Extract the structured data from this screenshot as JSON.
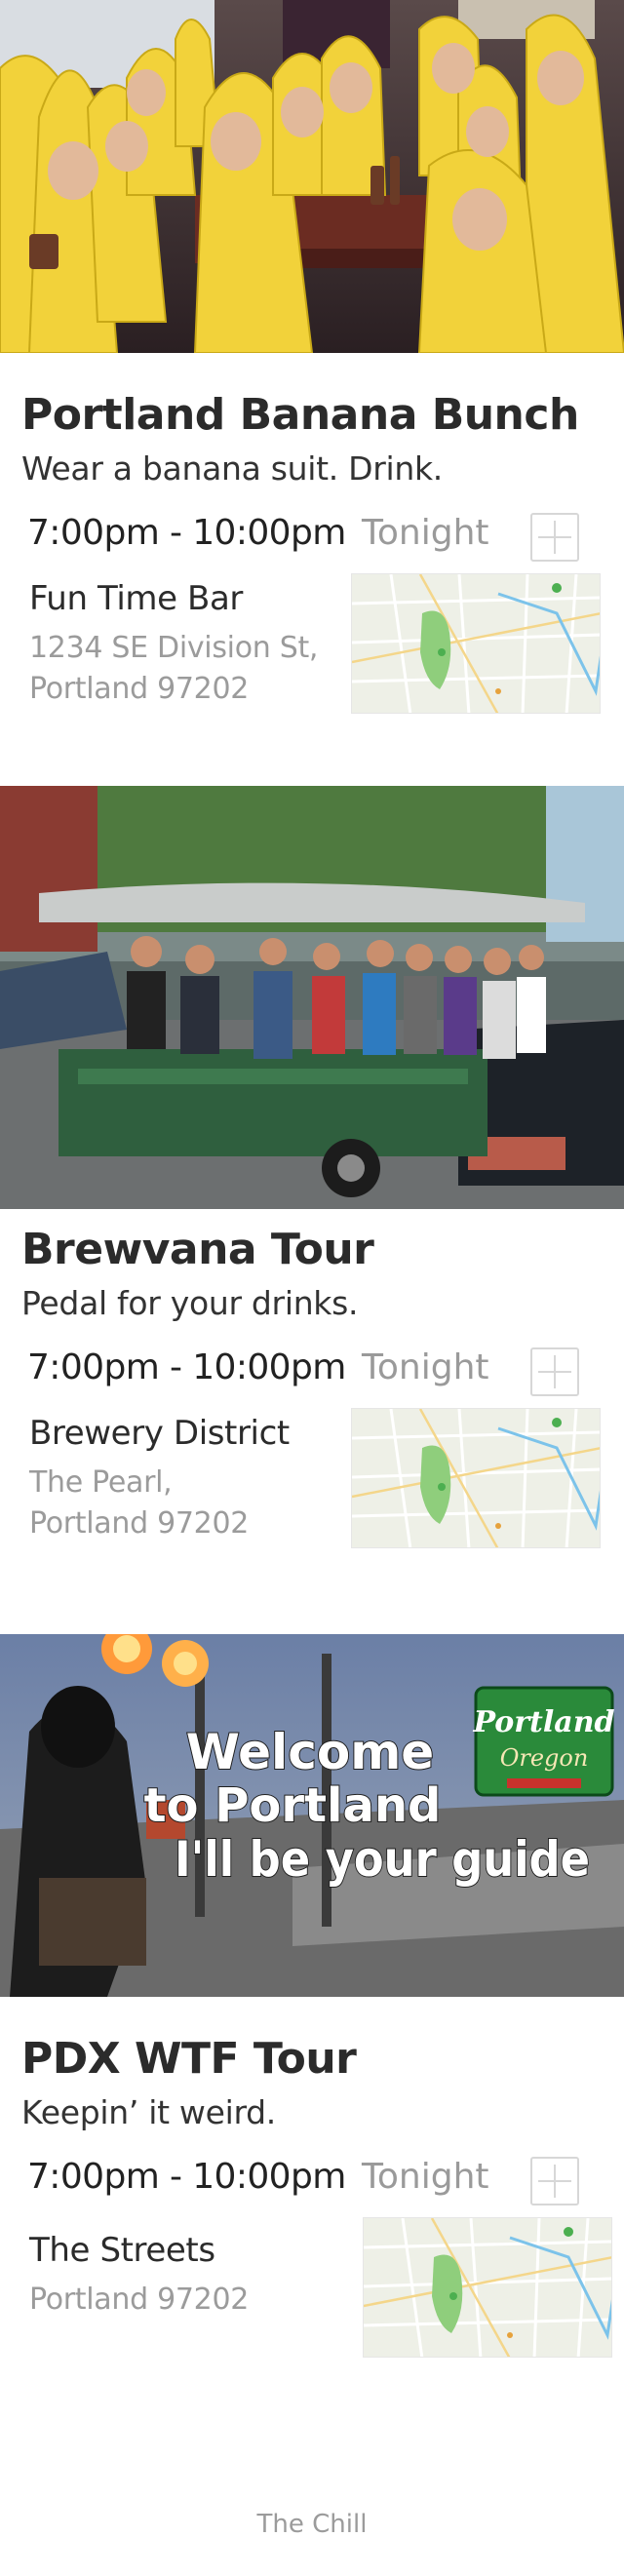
{
  "events": [
    {
      "image_alt": "Group of people in banana suits at a bar",
      "title": "Portland Banana Bunch",
      "tagline": "Wear a banana suit. Drink.",
      "time": "7:00pm - 10:00pm",
      "when": "Tonight",
      "venue": "Fun Time Bar",
      "address_line1": "1234 SE Division St,",
      "address_line2": "Portland 97202",
      "add_icon": "plus-icon"
    },
    {
      "image_alt": "Pedal pub bike full of riders on a street",
      "title": "Brewvana Tour",
      "tagline": "Pedal for your drinks.",
      "time": "7:00pm - 10:00pm",
      "when": "Tonight",
      "venue": "Brewery District",
      "address_line1": "The Pearl,",
      "address_line2": "Portland 97202",
      "add_icon": "plus-icon"
    },
    {
      "image_alt": "Bagpiper in costume with flaming pipes on a bridge",
      "image_caption_line1": "Welcome",
      "image_caption_line2": "to Portland",
      "image_caption_line3": "I'll be your guide",
      "sign_line1": "Portland",
      "sign_line2": "Oregon",
      "title": "PDX WTF Tour",
      "tagline": "Keepin’ it weird.",
      "time": "7:00pm - 10:00pm",
      "when": "Tonight",
      "venue": "The Streets",
      "address_line1": "Portland 97202",
      "add_icon": "plus-icon"
    }
  ],
  "footer": "The Chill",
  "colors": {
    "banana": "#f2d23a",
    "map_bg": "#eef0e7",
    "map_park": "#8fce7c",
    "map_water": "#7cc3ea",
    "muted_text": "#9b9b9b"
  }
}
